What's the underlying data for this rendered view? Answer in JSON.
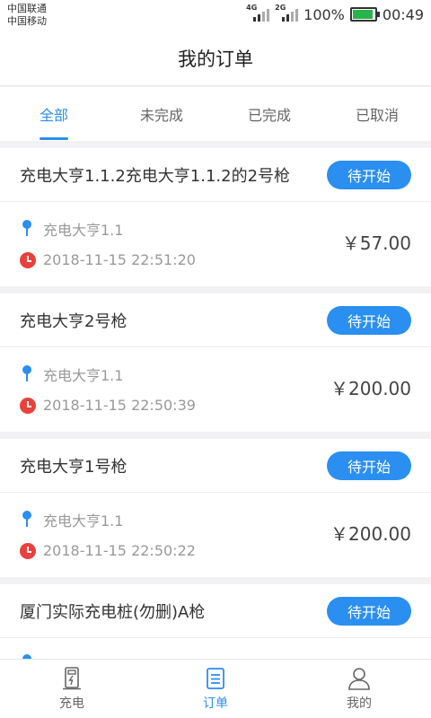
{
  "status_bar": {
    "carrier1": "中国联通",
    "carrier2": "中国移动",
    "signal1": "4G",
    "signal2": "2G",
    "battery": "100%",
    "time": "00:49"
  },
  "header": {
    "title": "我的订单"
  },
  "tabs": [
    {
      "label": "全部",
      "active": true
    },
    {
      "label": "未完成"
    },
    {
      "label": "已完成"
    },
    {
      "label": "已取消"
    }
  ],
  "orders": [
    {
      "title": "充电大亨1.1.2充电大亨1.1.2的2号枪",
      "status": "待开始",
      "station": "充电大亨1.1",
      "time": "2018-11-15 22:51:20",
      "price": "￥57.00"
    },
    {
      "title": "充电大亨2号枪",
      "status": "待开始",
      "station": "充电大亨1.1",
      "time": "2018-11-15 22:50:39",
      "price": "￥200.00"
    },
    {
      "title": "充电大亨1号枪",
      "status": "待开始",
      "station": "充电大亨1.1",
      "time": "2018-11-15 22:50:22",
      "price": "￥200.00"
    },
    {
      "title": "厦门实际充电桩(勿删)A枪",
      "status": "待开始",
      "station": "",
      "time": "",
      "price": ""
    }
  ],
  "bottom_nav": [
    {
      "label": "充电",
      "icon": "charger-icon"
    },
    {
      "label": "订单",
      "icon": "orders-icon",
      "active": true
    },
    {
      "label": "我的",
      "icon": "profile-icon"
    }
  ],
  "colors": {
    "accent": "#2a8ff0",
    "clock": "#e8413b",
    "battery": "#27b44a"
  }
}
